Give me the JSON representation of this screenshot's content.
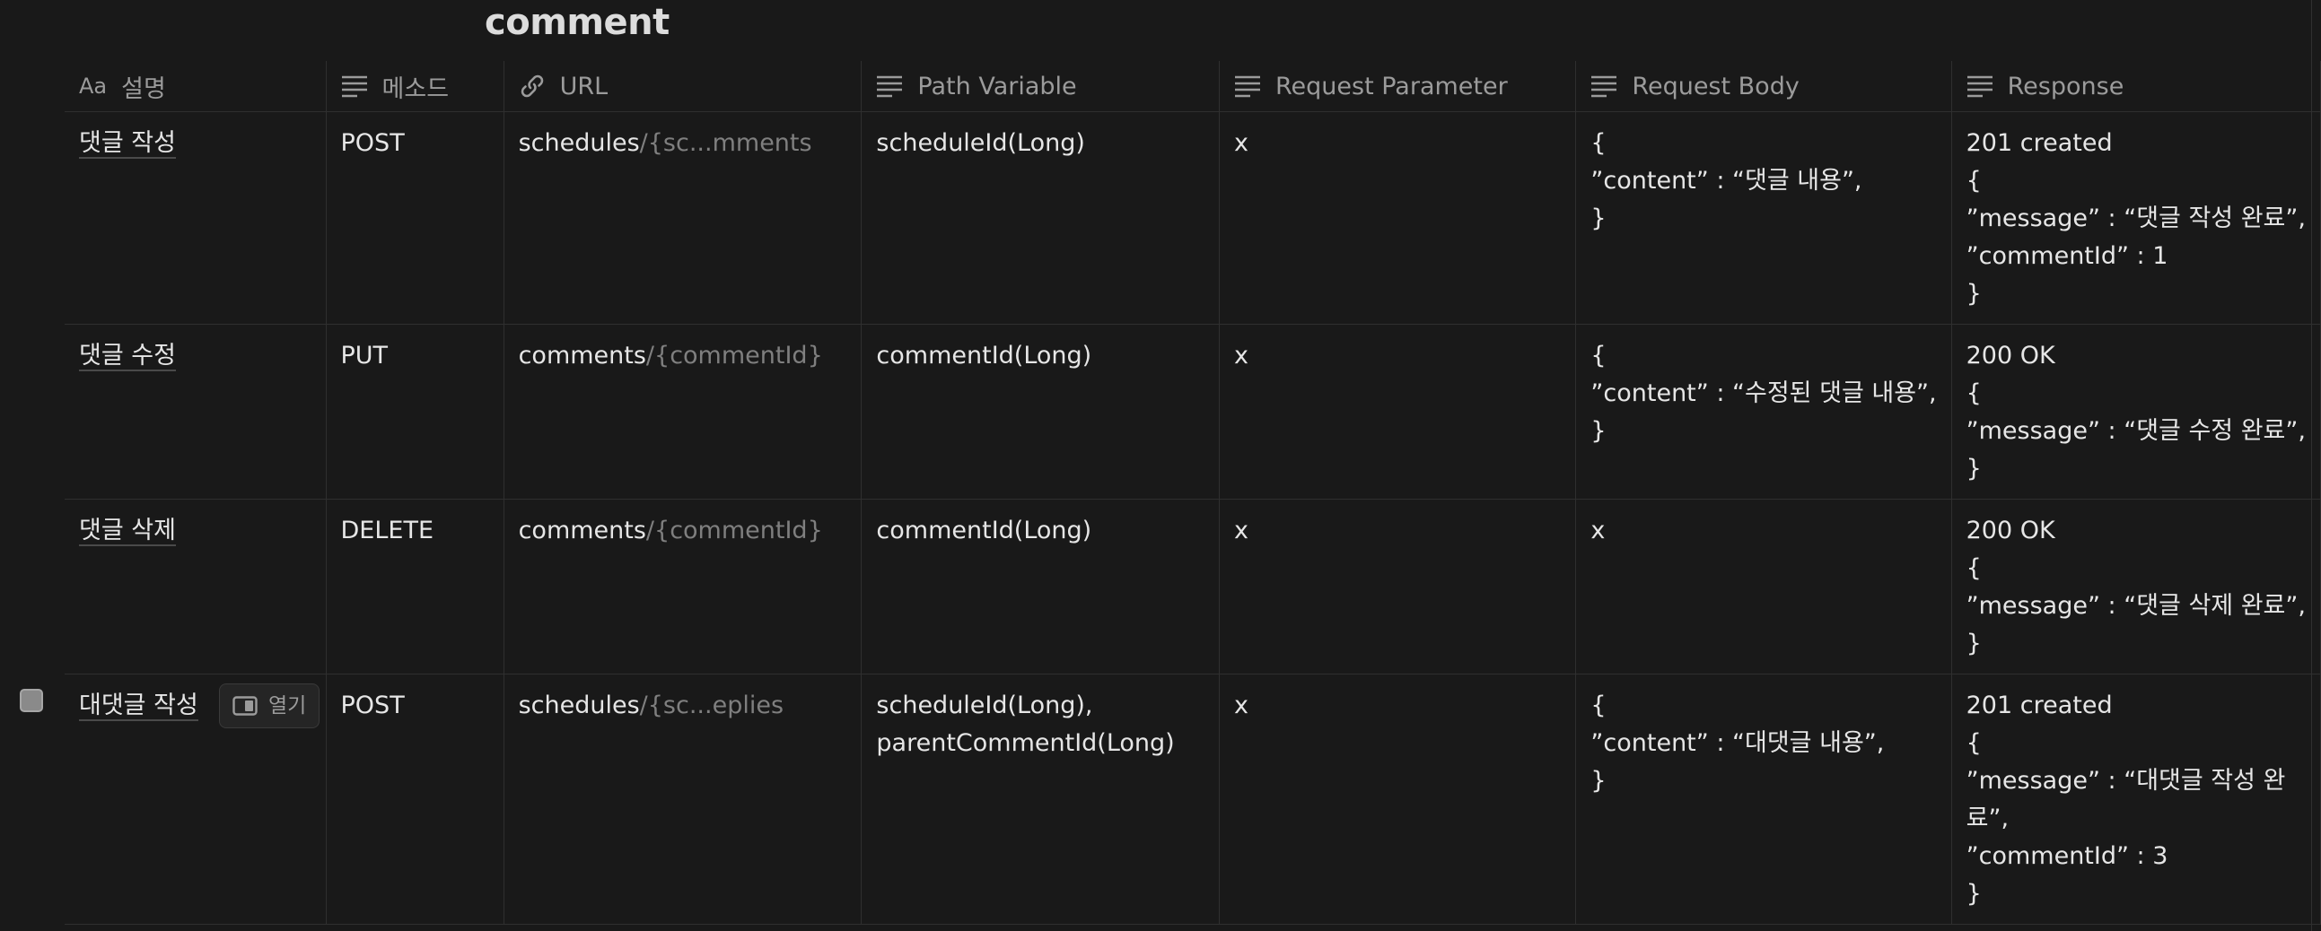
{
  "database": {
    "title": "comment"
  },
  "columns": [
    {
      "label": "설명",
      "icon": "title-aa-icon",
      "icon_text": "Aa"
    },
    {
      "label": "메소드",
      "icon": "text-lines-icon"
    },
    {
      "label": "URL",
      "icon": "link-icon"
    },
    {
      "label": "Path Variable",
      "icon": "text-lines-icon"
    },
    {
      "label": "Request Parameter",
      "icon": "text-lines-icon"
    },
    {
      "label": "Request Body",
      "icon": "text-lines-icon"
    },
    {
      "label": "Response",
      "icon": "text-lines-icon"
    }
  ],
  "rows": [
    {
      "name": "댓글 작성",
      "method": "POST",
      "url_main": "schedules",
      "url_dim": "/{sc...mments",
      "path_variable": [
        "scheduleId(Long)"
      ],
      "request_parameter": "x",
      "request_body": [
        "{",
        "”content” : “댓글 내용”,",
        "}"
      ],
      "response": [
        "201 created",
        "{",
        "”message” : “댓글 작성 완료”,",
        "”commentId” : 1",
        "}"
      ]
    },
    {
      "name": "댓글 수정",
      "method": "PUT",
      "url_main": "comments",
      "url_dim": "/{commentId}",
      "path_variable": [
        "commentId(Long)"
      ],
      "request_parameter": "x",
      "request_body": [
        "{",
        "”content” : “수정된 댓글 내용”,",
        "}"
      ],
      "response": [
        "200 OK",
        "{",
        "”message” : “댓글 수정 완료”,",
        "}"
      ]
    },
    {
      "name": "댓글 삭제",
      "method": "DELETE",
      "url_main": "comments",
      "url_dim": "/{commentId}",
      "path_variable": [
        "commentId(Long)"
      ],
      "request_parameter": "x",
      "request_body": [
        "x"
      ],
      "response": [
        "200 OK",
        "{",
        "”message” : “댓글 삭제 완료”,",
        "}"
      ]
    },
    {
      "name": "대댓글 작성",
      "open_label": "열기",
      "method": "POST",
      "url_main": "schedules",
      "url_dim": "/{sc...eplies",
      "path_variable": [
        "scheduleId(Long),",
        "parentCommentId(Long)"
      ],
      "request_parameter": "x",
      "request_body": [
        "{",
        "”content” : “대댓글 내용”,",
        "}"
      ],
      "response": [
        "201 created",
        "{",
        "”message” : “대댓글 작성 완",
        "료”,",
        "”commentId” : 3",
        "}"
      ]
    }
  ]
}
